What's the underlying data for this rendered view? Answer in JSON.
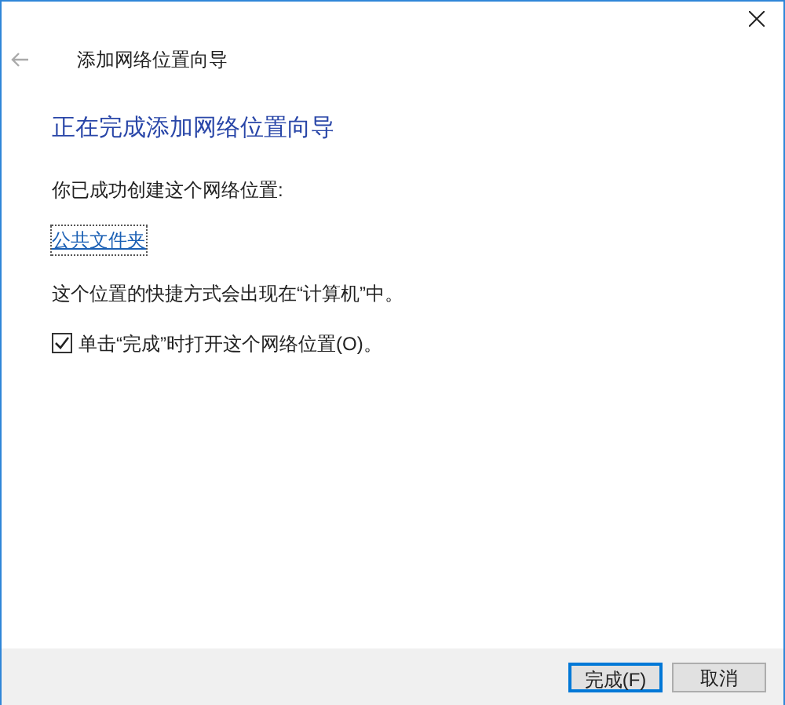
{
  "window": {
    "title": "添加网络位置向导"
  },
  "heading": "正在完成添加网络位置向导",
  "intro": "你已成功创建这个网络位置:",
  "location_link": "公共文件夹",
  "note": "这个位置的快捷方式会出现在“计算机”中。",
  "open_checkbox": {
    "label": "单击“完成”时打开这个网络位置(O)。",
    "checked": true
  },
  "buttons": [
    {
      "label": "完成(F)",
      "default": true
    },
    {
      "label": "取消",
      "default": false
    }
  ]
}
